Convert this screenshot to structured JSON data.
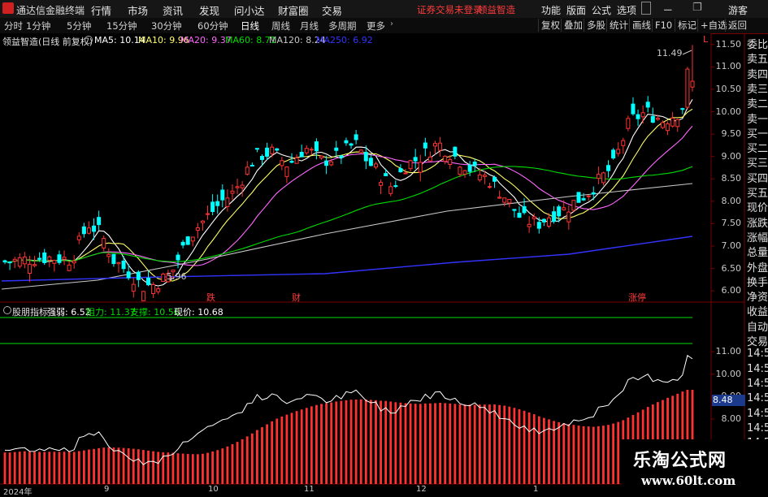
{
  "titlebar": {
    "app_name": "通达信金融终端",
    "menus": [
      "行情",
      "市场",
      "资讯",
      "发现",
      "问小达",
      "财富圈",
      "交易"
    ],
    "login_warning": "证券交易未登录",
    "current_stock": "领益智造",
    "right_menus": [
      "功能",
      "版面",
      "公式",
      "选项"
    ],
    "guest": "游客"
  },
  "toolbar": {
    "periods": [
      "分时",
      "1分钟",
      "5分钟",
      "15分钟",
      "30分钟",
      "60分钟",
      "日线",
      "周线",
      "月线",
      "多周期",
      "更多"
    ],
    "active_period": "日线",
    "buttons": [
      "复权",
      "叠加",
      "多股",
      "统计",
      "画线",
      "F10",
      "标记",
      "+自选",
      "返回"
    ]
  },
  "main_chart": {
    "stock_title": "领益智造(日线 前复权)",
    "ma_legend": [
      {
        "label": "MA5: 10.14",
        "color": "#ffffff"
      },
      {
        "label": "MA10: 9.96",
        "color": "#ffff66"
      },
      {
        "label": "MA20: 9.37",
        "color": "#ff66ff"
      },
      {
        "label": "MA60: 8.71",
        "color": "#00dd00"
      },
      {
        "label": "MA120: 8.24",
        "color": "#c8c8c8"
      },
      {
        "label": "MA250: 6.92",
        "color": "#3333ff"
      }
    ],
    "y_ticks": [
      "11.50",
      "11.00",
      "10.50",
      "10.00",
      "9.50",
      "9.00",
      "8.50",
      "8.00",
      "7.50",
      "7.00",
      "6.50",
      "6.00"
    ],
    "high_label": "11.49",
    "low_label": "5.96",
    "event_tags": [
      "跌",
      "财",
      "涨停"
    ],
    "corner_marker": "L"
  },
  "indicator": {
    "name": "股朋指标",
    "strength": "强弱: 6.52",
    "resistance": "阻力: 11.37",
    "support": "支撑: 10.56",
    "current": "现价: 10.68",
    "y_ticks": [
      "11.00",
      "10.00",
      "9.00",
      "8.00"
    ],
    "current_tag": "8.48"
  },
  "x_axis": [
    "2024年",
    "9",
    "10",
    "11",
    "12",
    "1"
  ],
  "right_panel": [
    "委比",
    "卖五",
    "卖四",
    "卖三",
    "卖二",
    "卖一",
    "买一",
    "买二",
    "买三",
    "买四",
    "买五",
    "现价",
    "涨跌",
    "涨幅",
    "总量",
    "外盘",
    "换手",
    "净资",
    "收益",
    "自动",
    "交易",
    "14:56",
    "14:56",
    "14:56",
    "14:56",
    "14:56",
    "14:56",
    "14:56",
    "14:56",
    "14:56"
  ],
  "watermark": {
    "title": "乐淘公式网",
    "url": "www.60lt.com"
  },
  "colors": {
    "up": "#ff3232",
    "down": "#00ffff",
    "frame": "#7a0000"
  }
}
